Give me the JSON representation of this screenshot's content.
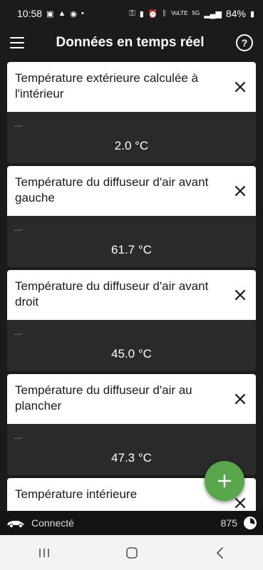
{
  "status_bar": {
    "time": "10:58",
    "battery_percent": "84%",
    "network_label": "5G",
    "volte_label": "VoLTE"
  },
  "app_bar": {
    "title": "Données en temps réel",
    "help_label": "?"
  },
  "cards": [
    {
      "title": "Température extérieure calculée à l'intérieur",
      "placeholder": "---",
      "value": "2.0 °C"
    },
    {
      "title": "Température du diffuseur d'air avant gauche",
      "placeholder": "---",
      "value": "61.7 °C"
    },
    {
      "title": "Température du diffuseur d'air avant droit",
      "placeholder": "---",
      "value": "45.0 °C"
    },
    {
      "title": "Température du diffuseur d'air au plancher",
      "placeholder": "---",
      "value": "47.3 °C"
    },
    {
      "title": "Température intérieure",
      "placeholder": "",
      "value": ""
    }
  ],
  "bottom_status": {
    "connection": "Connecté",
    "count": "875"
  },
  "colors": {
    "accent": "#5aa64d",
    "background": "#1b1b1b",
    "card_body": "#2a2a2a"
  }
}
